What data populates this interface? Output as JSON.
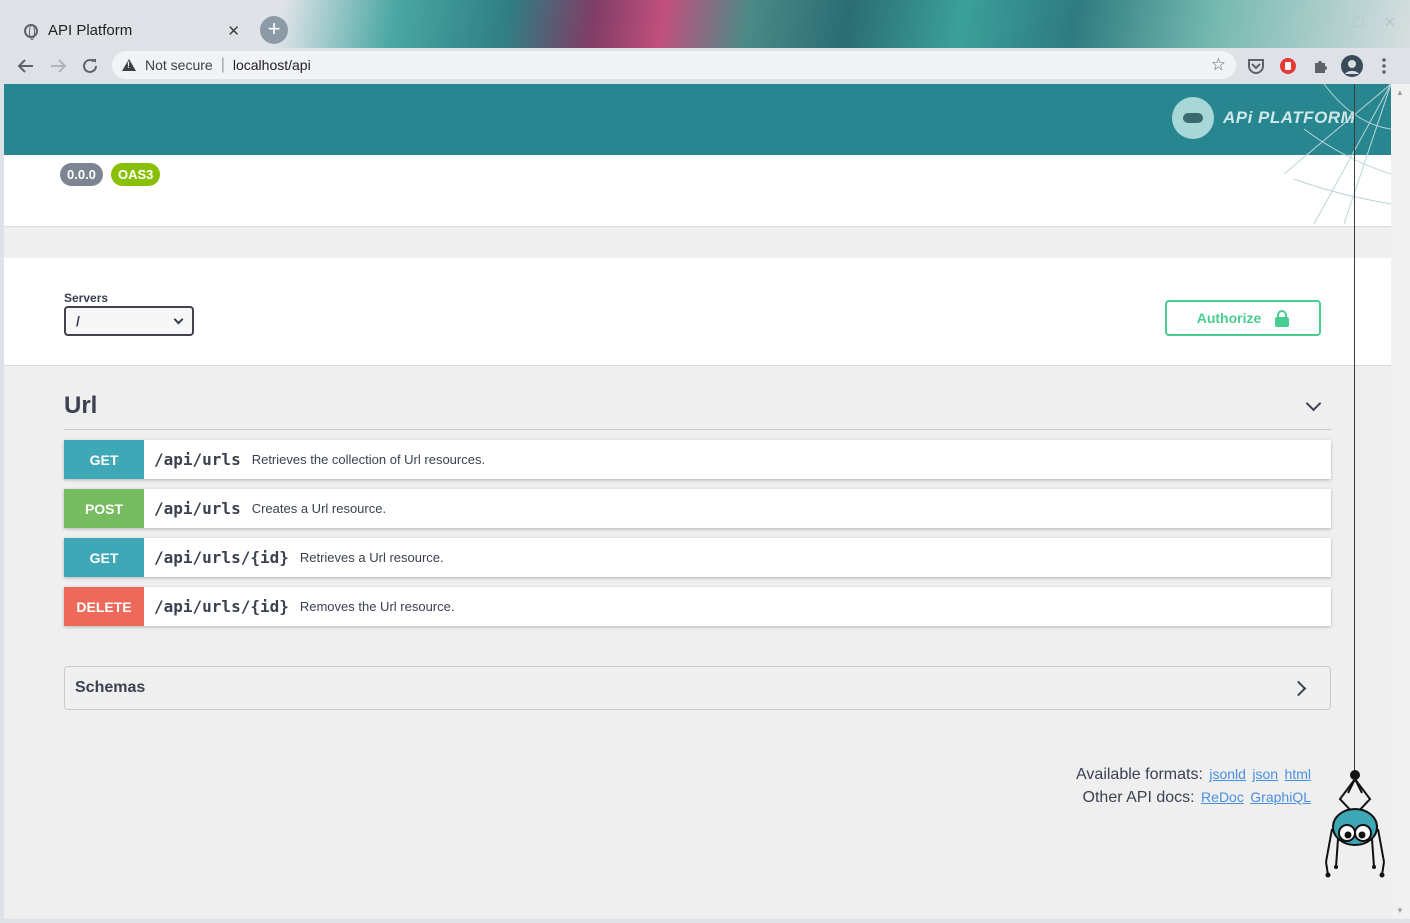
{
  "browser": {
    "tab_title": "API Platform",
    "tab_close": "✕",
    "new_tab": "+",
    "security_label": "Not secure",
    "url": "localhost/api"
  },
  "header": {
    "logo_text": "APi PLATFORM"
  },
  "info": {
    "version_badge": "0.0.0",
    "oas_badge": "OAS3",
    "version_color": "#89bf04",
    "badge_gray": "#7d8492"
  },
  "servers": {
    "label": "Servers",
    "selected": "/"
  },
  "authorize": {
    "label": "Authorize"
  },
  "tag": {
    "name": "Url"
  },
  "operations": [
    {
      "method": "GET",
      "path": "/api/urls",
      "summary": "Retrieves the collection of Url resources.",
      "color": "#3ea8b6"
    },
    {
      "method": "POST",
      "path": "/api/urls",
      "summary": "Creates a Url resource.",
      "color": "#78bc61"
    },
    {
      "method": "GET",
      "path": "/api/urls/{id}",
      "summary": "Retrieves a Url resource.",
      "color": "#3ea8b6"
    },
    {
      "method": "DELETE",
      "path": "/api/urls/{id}",
      "summary": "Removes the Url resource.",
      "color": "#ed6a5a"
    }
  ],
  "schemas": {
    "label": "Schemas"
  },
  "footer": {
    "formats_label": "Available formats:",
    "formats": [
      "jsonld",
      "json",
      "html"
    ],
    "docs_label": "Other API docs:",
    "docs": [
      "ReDoc",
      "GraphiQL"
    ]
  },
  "colors": {
    "header_bg": "#288690",
    "authorize": "#49cc90"
  }
}
